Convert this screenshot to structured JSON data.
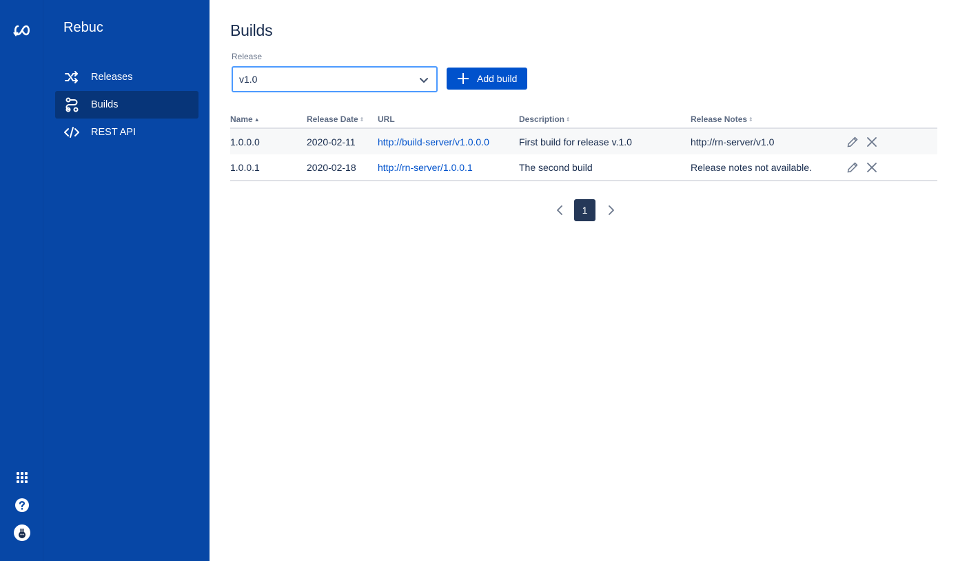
{
  "app": {
    "name": "Rebuc"
  },
  "global_nav": {
    "logo_icon": "infinity-logo-icon",
    "bottom_icons": [
      "app-switcher-icon",
      "help-icon",
      "avatar"
    ]
  },
  "sidebar": {
    "items": [
      {
        "label": "Releases",
        "icon": "shuffle-icon",
        "active": false
      },
      {
        "label": "Builds",
        "icon": "builds-icon",
        "active": true
      },
      {
        "label": "REST API",
        "icon": "code-icon",
        "active": false
      }
    ]
  },
  "page": {
    "title": "Builds",
    "release_label": "Release",
    "release_selected": "v1.0",
    "add_button": "Add build"
  },
  "table": {
    "columns": [
      {
        "label": "Name",
        "sort": "asc"
      },
      {
        "label": "Release Date",
        "sort": "none"
      },
      {
        "label": "URL",
        "sort": null
      },
      {
        "label": "Description",
        "sort": "none"
      },
      {
        "label": "Release Notes",
        "sort": "none"
      }
    ],
    "rows": [
      {
        "name": "1.0.0.0",
        "date": "2020-02-11",
        "url": "http://build-server/v1.0.0.0",
        "description": "First build for release v.1.0",
        "notes": "http://rn-server/v1.0"
      },
      {
        "name": "1.0.0.1",
        "date": "2020-02-18",
        "url": "http://rn-server/1.0.0.1",
        "description": "The second build",
        "notes": "Release notes not available."
      }
    ]
  },
  "pagination": {
    "current": "1"
  },
  "colors": {
    "sidebar": "#0747a6",
    "primary": "#0052cc",
    "link": "#0052cc",
    "focus": "#4c9aff",
    "page_active": "#253858"
  }
}
